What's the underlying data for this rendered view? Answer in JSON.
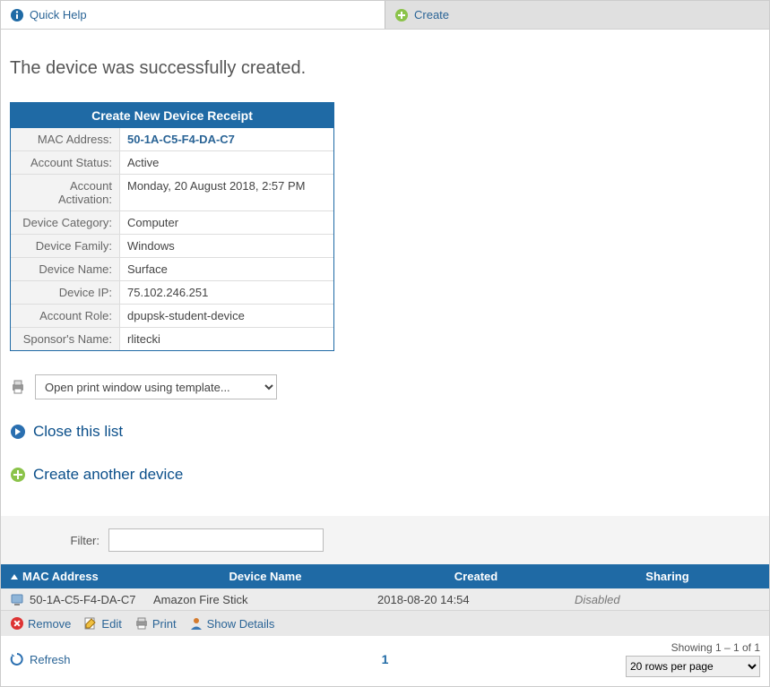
{
  "topbar": {
    "help_label": "Quick Help",
    "create_label": "Create"
  },
  "success_message": "The device was successfully created.",
  "receipt": {
    "title": "Create New Device Receipt",
    "rows": [
      {
        "label": "MAC Address:",
        "value": "50-1A-C5-F4-DA-C7",
        "link": true
      },
      {
        "label": "Account Status:",
        "value": "Active"
      },
      {
        "label": "Account Activation:",
        "value": "Monday, 20 August 2018, 2:57 PM"
      },
      {
        "label": "Device Category:",
        "value": "Computer"
      },
      {
        "label": "Device Family:",
        "value": "Windows"
      },
      {
        "label": "Device Name:",
        "value": "Surface"
      },
      {
        "label": "Device IP:",
        "value": "75.102.246.251"
      },
      {
        "label": "Account Role:",
        "value": "dpupsk-student-device"
      },
      {
        "label": "Sponsor's Name:",
        "value": "rlitecki"
      }
    ]
  },
  "print_select_label": "Open print window using template...",
  "close_list_label": "Close this list",
  "create_another_label": "Create another device",
  "filter": {
    "label": "Filter:",
    "value": ""
  },
  "table": {
    "headers": {
      "mac": "MAC Address",
      "device_name": "Device Name",
      "created": "Created",
      "sharing": "Sharing"
    },
    "rows": [
      {
        "mac": "50-1A-C5-F4-DA-C7",
        "device_name": "Amazon Fire Stick",
        "created": "2018-08-20 14:54",
        "sharing": "Disabled"
      }
    ],
    "actions": {
      "remove": "Remove",
      "edit": "Edit",
      "print": "Print",
      "show_details": "Show Details"
    }
  },
  "footer": {
    "refresh": "Refresh",
    "page": "1",
    "showing": "Showing 1 – 1 of 1",
    "rows_per_page": "20 rows per page"
  }
}
